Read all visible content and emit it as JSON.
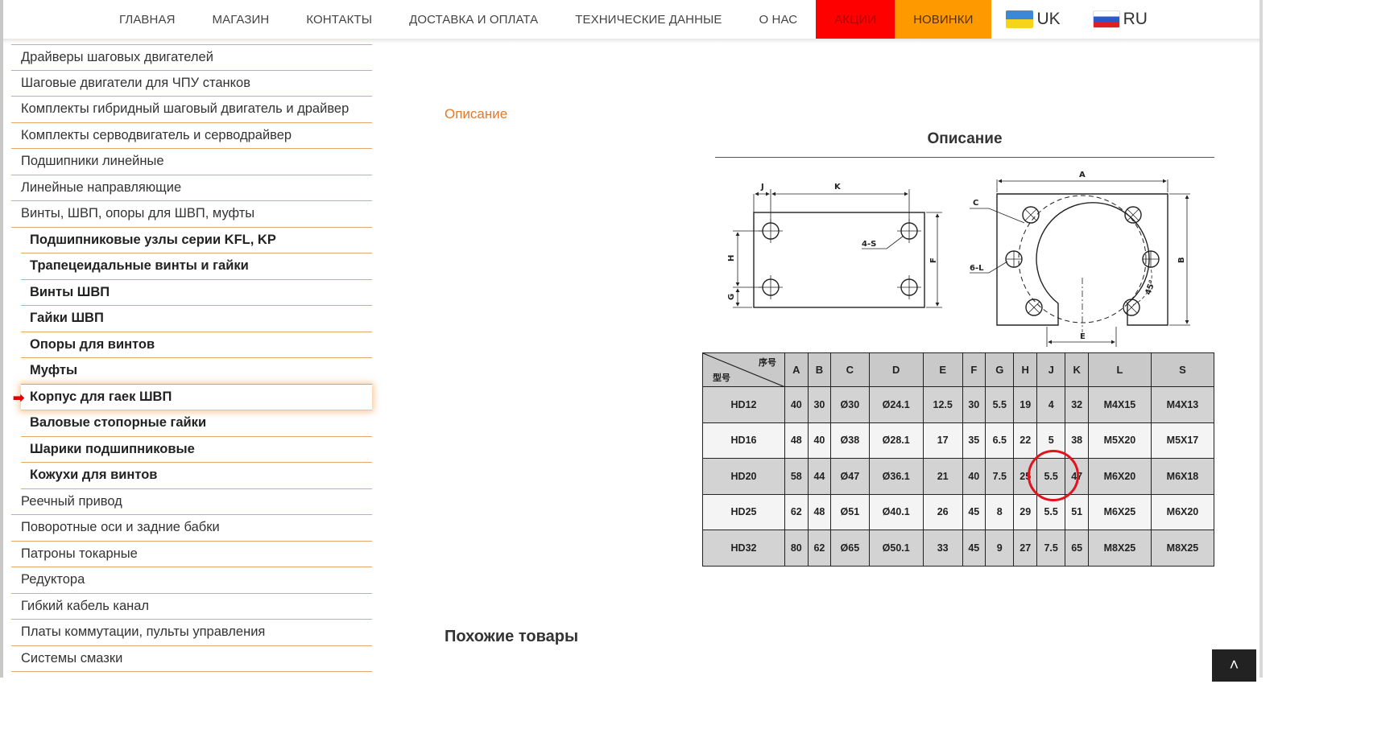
{
  "nav": {
    "items": [
      "ГЛАВНАЯ",
      "МАГАЗИН",
      "КОНТАКТЫ",
      "ДОСТАВКА И ОПЛАТА",
      "ТЕХНИЧЕСКИЕ ДАННЫЕ",
      "О НАС"
    ],
    "sale": "АКЦИИ",
    "new": "НОВИНКИ",
    "lang_uk": "UK",
    "lang_ru": "RU",
    "colors": {
      "sale_bg": "#ff0000",
      "new_bg": "#ff9900"
    }
  },
  "sidebar": {
    "items": [
      "Драйверы шаговых двигателей",
      "Шаговые двигатели для ЧПУ станков",
      "Комплекты гибридный шаговый двигатель и драйвер",
      "Комплекты серводвигатель и серводрайвер",
      "Подшипники линейные",
      "Линейные направляющие",
      "Винты, ШВП, опоры для ШВП, муфты"
    ],
    "subitems": [
      "Подшипниковые узлы серии KFL, KP",
      "Трапецеидальные винты и гайки",
      "Винты ШВП",
      "Гайки ШВП",
      "Опоры для винтов",
      "Муфты",
      "Корпус для гаек ШВП",
      "Валовые стопорные гайки",
      "Шарики подшипниковые",
      "Кожухи для винтов"
    ],
    "active_index": 6,
    "items_after": [
      "Реечный привод",
      "Поворотные оси и задние бабки",
      "Патроны токарные",
      "Редуктора",
      "Гибкий кабель канал",
      "Платы коммутации, пульты управления",
      "Системы смазки"
    ],
    "accent_color": "#e8a66b"
  },
  "main": {
    "tab_label": "Описание",
    "title": "Описание",
    "similar_title": "Похожие товары",
    "to_top_icon": "chevron-up-icon"
  },
  "drawing": {
    "left_labels": [
      "J",
      "K",
      "4-S",
      "H",
      "G",
      "F"
    ],
    "right_labels": [
      "A",
      "C",
      "6-L",
      "B",
      "E",
      "45°"
    ]
  },
  "spec_table": {
    "corner_top": "序号",
    "corner_bottom": "型号",
    "columns": [
      "A",
      "B",
      "C",
      "D",
      "E",
      "F",
      "G",
      "H",
      "J",
      "K",
      "L",
      "S"
    ],
    "rows": [
      {
        "model": "HD12",
        "values": [
          "40",
          "30",
          "Ø30",
          "Ø24.1",
          "12.5",
          "30",
          "5.5",
          "19",
          "4",
          "32",
          "M4X15",
          "M4X13"
        ]
      },
      {
        "model": "HD16",
        "values": [
          "48",
          "40",
          "Ø38",
          "Ø28.1",
          "17",
          "35",
          "6.5",
          "22",
          "5",
          "38",
          "M5X20",
          "M5X17"
        ]
      },
      {
        "model": "HD20",
        "values": [
          "58",
          "44",
          "Ø47",
          "Ø36.1",
          "21",
          "40",
          "7.5",
          "25",
          "5.5",
          "47",
          "M6X20",
          "M6X18"
        ]
      },
      {
        "model": "HD25",
        "values": [
          "62",
          "48",
          "Ø51",
          "Ø40.1",
          "26",
          "45",
          "8",
          "29",
          "5.5",
          "51",
          "M6X25",
          "M6X20"
        ]
      },
      {
        "model": "HD32",
        "values": [
          "80",
          "62",
          "Ø65",
          "Ø50.1",
          "33",
          "45",
          "9",
          "27",
          "7.5",
          "65",
          "M8X25",
          "M8X25"
        ]
      }
    ],
    "highlight": {
      "row": 2,
      "col": 7,
      "color": "#e0141e"
    }
  }
}
